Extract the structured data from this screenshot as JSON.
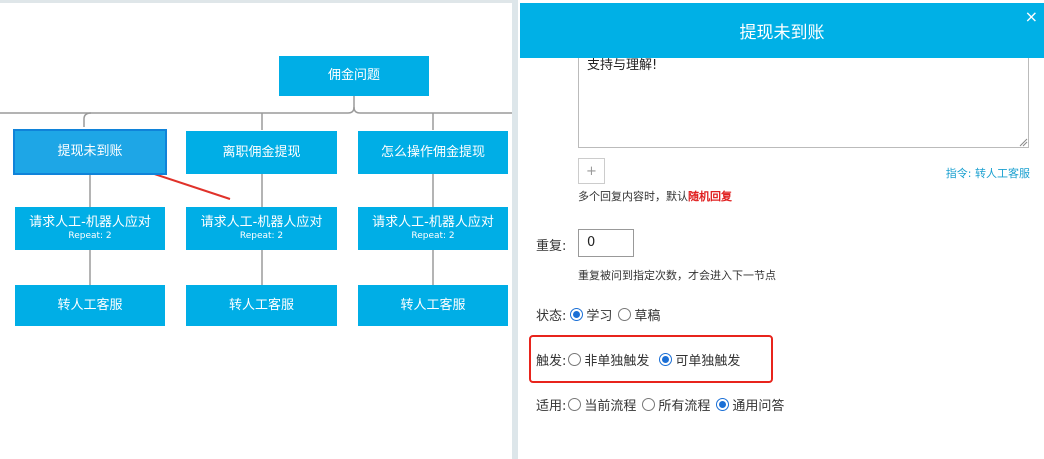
{
  "flow": {
    "root": "佣金问题",
    "branches": [
      {
        "title": "提现未到账",
        "action": "请求人工-机器人应对",
        "repeat": "Repeat: 2",
        "leaf": "转人工客服"
      },
      {
        "title": "离职佣金提现",
        "action": "请求人工-机器人应对",
        "repeat": "Repeat: 2",
        "leaf": "转人工客服"
      },
      {
        "title": "怎么操作佣金提现",
        "action": "请求人工-机器人应对",
        "repeat": "Repeat: 2",
        "leaf": "转人工客服"
      }
    ]
  },
  "panel": {
    "title": "提现未到账",
    "close_icon": "×",
    "reply_text": "支持与理解!",
    "add_button": "+",
    "command": "指令: 转人工客服",
    "hint_prefix": "多个回复内容时，默认",
    "hint_emphasis": "随机回复",
    "repeat_label": "重复:",
    "repeat_value": "0",
    "repeat_hint": "重复被问到指定次数，才会进入下一节点",
    "status_label": "状态:",
    "status_options": [
      {
        "label": "学习",
        "checked": true
      },
      {
        "label": "草稿",
        "checked": false
      }
    ],
    "trigger_label": "触发:",
    "trigger_options": [
      {
        "label": "非单独触发",
        "checked": false
      },
      {
        "label": "可单独触发",
        "checked": true
      }
    ],
    "apply_label": "适用:",
    "apply_options": [
      {
        "label": "当前流程",
        "checked": false
      },
      {
        "label": "所有流程",
        "checked": false
      },
      {
        "label": "通用问答",
        "checked": true
      }
    ]
  },
  "colors": {
    "node": "#00aee6",
    "header": "#00b0e6",
    "highlight": "#e8241c",
    "radio": "#1a6fd6"
  }
}
